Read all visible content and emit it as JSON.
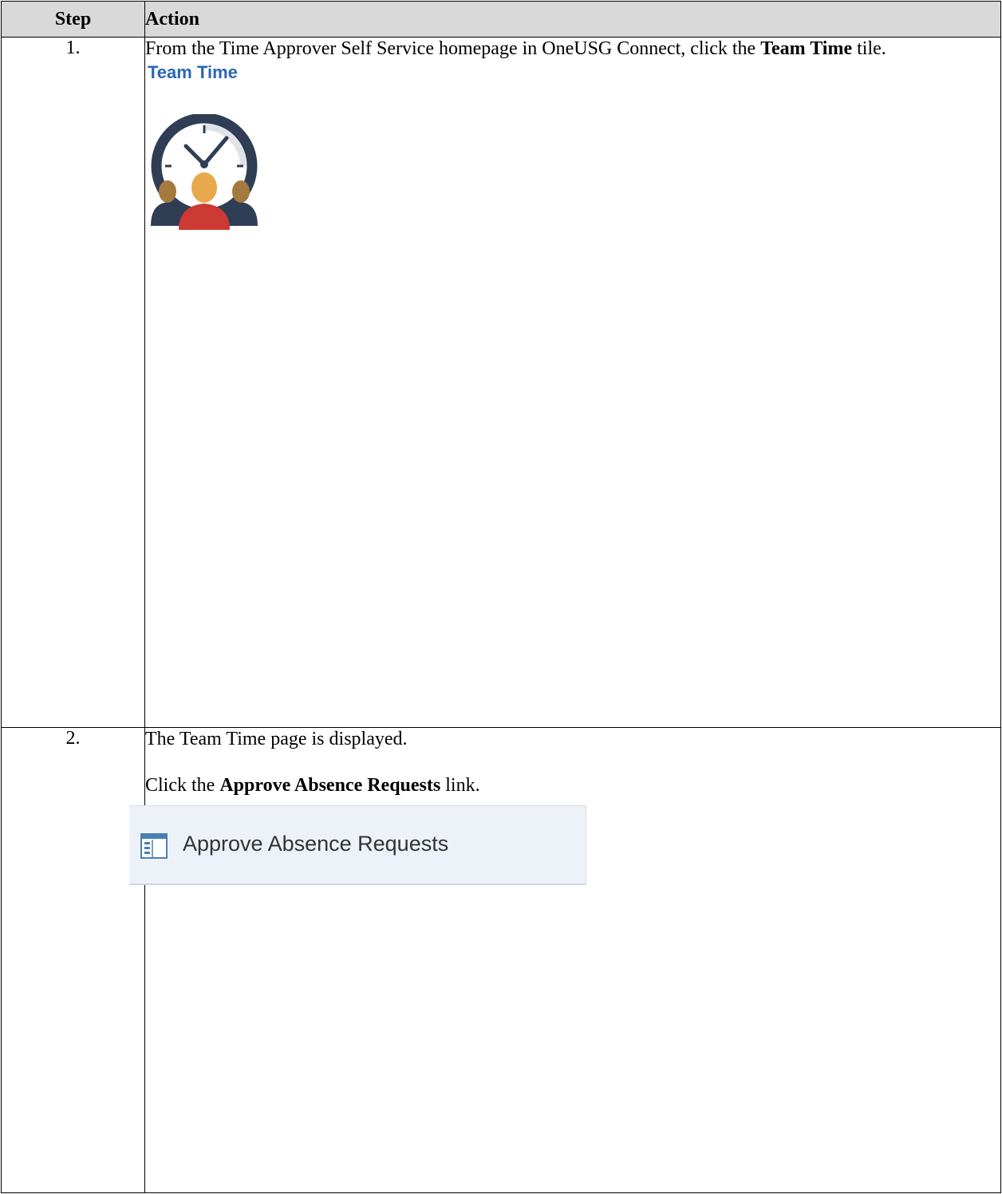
{
  "table": {
    "header": {
      "step": "Step",
      "action": "Action"
    },
    "rows": [
      {
        "step": "1.",
        "text_before": "From the Time Approver Self Service homepage in OneUSG Connect, click the ",
        "bold": "Team Time",
        "text_after": " tile.",
        "tile_title": "Team Time",
        "tile_icon": "clock-team-icon"
      },
      {
        "step": "2.",
        "line1": "The Team Time page is displayed.",
        "line2_before": "Click the ",
        "bold": "Approve Absence Requests",
        "line2_after": " link.",
        "link_label": "Approve Absence Requests",
        "link_icon": "page-list-icon"
      }
    ]
  },
  "colors": {
    "header_bg": "#d9d9d9",
    "tile_title": "#2a66b3",
    "link_bg": "#edf2f9",
    "clock_ring": "#2f3e55",
    "person_center": "#e8a84c",
    "person_body": "#cc3a33",
    "person_side": "#a57a3e"
  }
}
